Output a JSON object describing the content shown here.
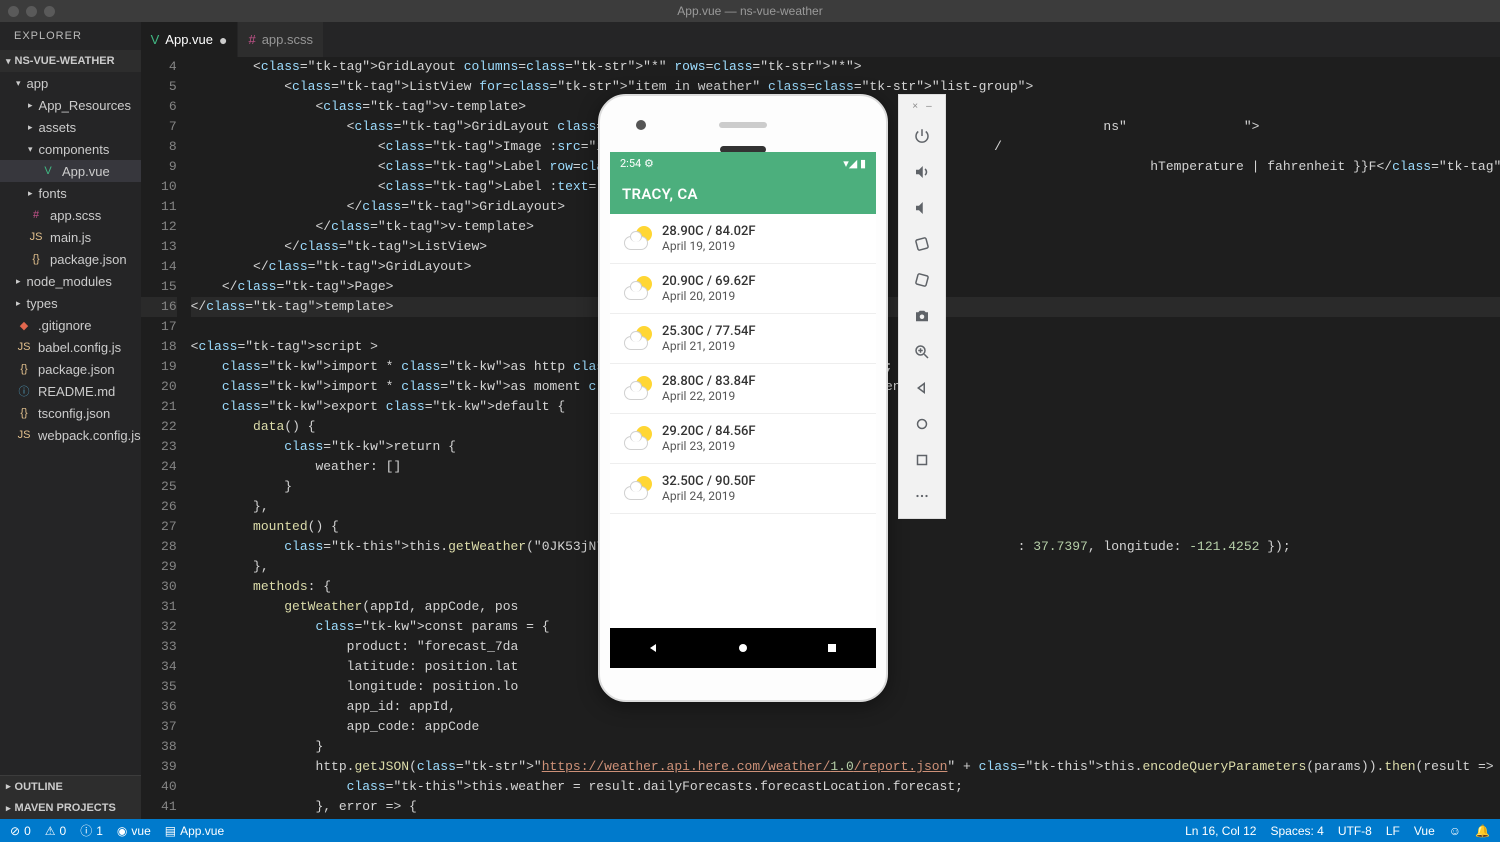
{
  "window": {
    "title": "App.vue — ns-vue-weather"
  },
  "sidebar": {
    "explorer": "EXPLORER",
    "project": "NS-VUE-WEATHER",
    "outline": "OUTLINE",
    "maven": "MAVEN PROJECTS",
    "items": [
      {
        "label": "app",
        "type": "folder",
        "open": true,
        "depth": 0
      },
      {
        "label": "App_Resources",
        "type": "folder",
        "depth": 1
      },
      {
        "label": "assets",
        "type": "folder",
        "depth": 1
      },
      {
        "label": "components",
        "type": "folder",
        "open": true,
        "depth": 1
      },
      {
        "label": "App.vue",
        "type": "vue",
        "depth": 2,
        "selected": true
      },
      {
        "label": "fonts",
        "type": "folder",
        "depth": 1
      },
      {
        "label": "app.scss",
        "type": "scss",
        "depth": 1
      },
      {
        "label": "main.js",
        "type": "js",
        "depth": 1
      },
      {
        "label": "package.json",
        "type": "json",
        "depth": 1
      },
      {
        "label": "node_modules",
        "type": "folder",
        "depth": 0
      },
      {
        "label": "types",
        "type": "folder",
        "depth": 0
      },
      {
        "label": ".gitignore",
        "type": "git",
        "depth": 0
      },
      {
        "label": "babel.config.js",
        "type": "js",
        "depth": 0
      },
      {
        "label": "package.json",
        "type": "json",
        "depth": 0
      },
      {
        "label": "README.md",
        "type": "md",
        "depth": 0
      },
      {
        "label": "tsconfig.json",
        "type": "json",
        "depth": 0
      },
      {
        "label": "webpack.config.js",
        "type": "js",
        "depth": 0
      }
    ]
  },
  "tabs": [
    {
      "label": "App.vue",
      "icon": "vue",
      "active": true,
      "dirty": true
    },
    {
      "label": "app.scss",
      "icon": "scss",
      "active": false
    }
  ],
  "code": {
    "start": 4,
    "current": 16,
    "lines": [
      "        <GridLayout columns=\"*\" rows=\"*\">",
      "            <ListView for=\"item in weather\" class=\"list-group\">",
      "                <v-template>",
      "                    <GridLayout class=\"list                                            ns\"               \">",
      "                        <Image :src=\"item.                                              /",
      "                        <Label row=\"0\" col                                                   hTemperature | fahrenheit }}F</Label>",
      "                        <Label :text=\"item",
      "                    </GridLayout>",
      "                </v-template>",
      "            </ListView>",
      "        </GridLayout>",
      "    </Page>",
      "</template>",
      "",
      "<script >",
      "    import * as http from \"http\";",
      "    import * as moment from \"moment\";",
      "    export default {",
      "        data() {",
      "            return {",
      "                weather: []",
      "            }",
      "        },",
      "        mounted() {",
      "            this.getWeather(\"0JK53jN7Faa5a                                                : 37.7397, longitude: -121.4252 });",
      "        },",
      "        methods: {",
      "            getWeather(appId, appCode, pos",
      "                const params = {",
      "                    product: \"forecast_7da",
      "                    latitude: position.lat",
      "                    longitude: position.lo",
      "                    app_id: appId,",
      "                    app_code: appCode",
      "                }",
      "                http.getJSON(\"https://weather.api.here.com/weather/1.0/report.json\" + this.encodeQueryParameters(params)).then(result => {",
      "                    this.weather = result.dailyForecasts.forecastLocation.forecast;",
      "                }, error => {"
    ]
  },
  "statusbar": {
    "errors": "0",
    "warnings": "0",
    "info": "1",
    "lang_hint": "vue",
    "file": "App.vue",
    "cursor": "Ln 16, Col 12",
    "spaces": "Spaces: 4",
    "encoding": "UTF-8",
    "eol": "LF",
    "mode": "Vue"
  },
  "emulator": {
    "time": "2:54",
    "gear": "⚙",
    "signal": "▾◢ ▮",
    "title": "TRACY, CA",
    "rows": [
      {
        "temp": "28.90C / 84.02F",
        "date": "April 19, 2019"
      },
      {
        "temp": "20.90C / 69.62F",
        "date": "April 20, 2019"
      },
      {
        "temp": "25.30C / 77.54F",
        "date": "April 21, 2019"
      },
      {
        "temp": "28.80C / 83.84F",
        "date": "April 22, 2019"
      },
      {
        "temp": "29.20C / 84.56F",
        "date": "April 23, 2019"
      },
      {
        "temp": "32.50C / 90.50F",
        "date": "April 24, 2019"
      }
    ]
  },
  "emu_toolbar": {
    "close": "×",
    "min": "–"
  }
}
